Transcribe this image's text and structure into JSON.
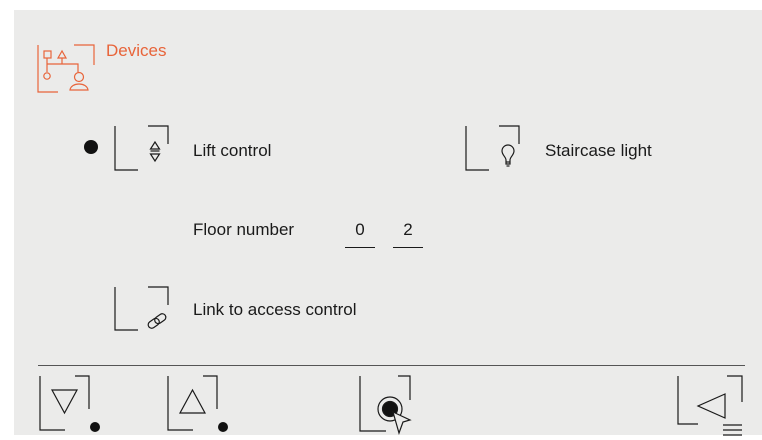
{
  "header": {
    "title": "Devices",
    "icon": "devices-network-person-icon",
    "accent_color": "#e8643a"
  },
  "options": {
    "lift_control": {
      "label": "Lift control",
      "icon": "up-down-arrows-icon",
      "selected": true
    },
    "staircase_light": {
      "label": "Staircase light",
      "icon": "lightbulb-icon",
      "selected": false
    },
    "floor_number": {
      "label": "Floor number",
      "digits": [
        "0",
        "2"
      ]
    },
    "access_control": {
      "label": "Link to access control",
      "icon": "chain-link-icon"
    }
  },
  "footer": {
    "buttons": [
      {
        "name": "down",
        "icon": "triangle-down-icon"
      },
      {
        "name": "up",
        "icon": "triangle-up-icon"
      },
      {
        "name": "select",
        "icon": "press-cursor-icon"
      },
      {
        "name": "back",
        "icon": "back-menu-icon"
      }
    ]
  }
}
